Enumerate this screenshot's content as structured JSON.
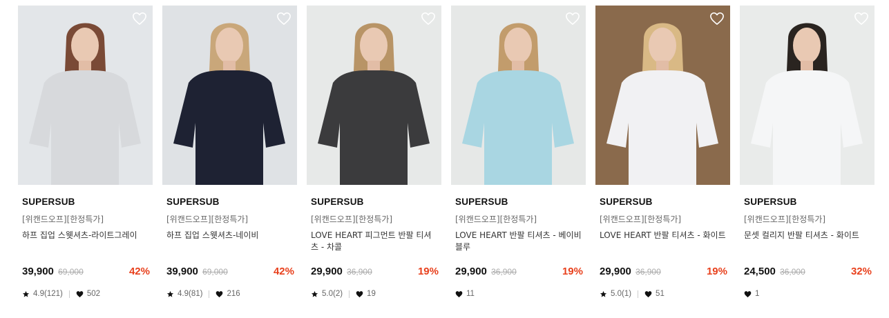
{
  "products": [
    {
      "brand": "SUPERSUB",
      "promo": "[위캔드오프][한정특가]",
      "name": "하프 집업 스웻셔츠-라이트그레이",
      "price": "39,900",
      "original_price": "69,000",
      "discount": "42%",
      "rating": "4.9(121)",
      "likes": "502",
      "has_rating": true,
      "bg": "#e3e6e9",
      "garment_color": "#d7d9dc",
      "hair_color": "#7a4a36"
    },
    {
      "brand": "SUPERSUB",
      "promo": "[위캔드오프][한정특가]",
      "name": "하프 집업 스웻셔츠-네이비",
      "price": "39,900",
      "original_price": "69,000",
      "discount": "42%",
      "rating": "4.9(81)",
      "likes": "216",
      "has_rating": true,
      "bg": "#dfe2e5",
      "garment_color": "#1e2233",
      "hair_color": "#c9a77a"
    },
    {
      "brand": "SUPERSUB",
      "promo": "[위캔드오프][한정특가]",
      "name": "LOVE HEART 피그먼트 반팔 티셔츠 - 차콜",
      "price": "29,900",
      "original_price": "36,900",
      "discount": "19%",
      "rating": "5.0(2)",
      "likes": "19",
      "has_rating": true,
      "bg": "#e7e9e8",
      "garment_color": "#3b3b3d",
      "hair_color": "#b89466"
    },
    {
      "brand": "SUPERSUB",
      "promo": "[위캔드오프][한정특가]",
      "name": "LOVE HEART 반팔 티셔츠 - 베이비블루",
      "price": "29,900",
      "original_price": "36,900",
      "discount": "19%",
      "rating": "",
      "likes": "11",
      "has_rating": false,
      "bg": "#e6e8e7",
      "garment_color": "#a9d6e2",
      "hair_color": "#c29c6c"
    },
    {
      "brand": "SUPERSUB",
      "promo": "[위캔드오프][한정특가]",
      "name": "LOVE HEART 반팔 티셔츠 - 화이트",
      "price": "29,900",
      "original_price": "36,900",
      "discount": "19%",
      "rating": "5.0(1)",
      "likes": "51",
      "has_rating": true,
      "bg": "#8a6a4c",
      "garment_color": "#f1f1f3",
      "hair_color": "#d9b985"
    },
    {
      "brand": "SUPERSUB",
      "promo": "[위캔드오프][한정특가]",
      "name": "문셋 컬리지 반팔 티셔츠 - 화이트",
      "price": "24,500",
      "original_price": "36,000",
      "discount": "32%",
      "rating": "",
      "likes": "1",
      "has_rating": false,
      "bg": "#e9ebea",
      "garment_color": "#f5f6f7",
      "hair_color": "#2a2420"
    }
  ],
  "colors": {
    "discount": "#e8401c",
    "heart_outline": "#ffffff"
  },
  "icons": {
    "wishlist": "heart-outline-icon",
    "rating": "star-icon",
    "likes": "heart-filled-icon"
  }
}
